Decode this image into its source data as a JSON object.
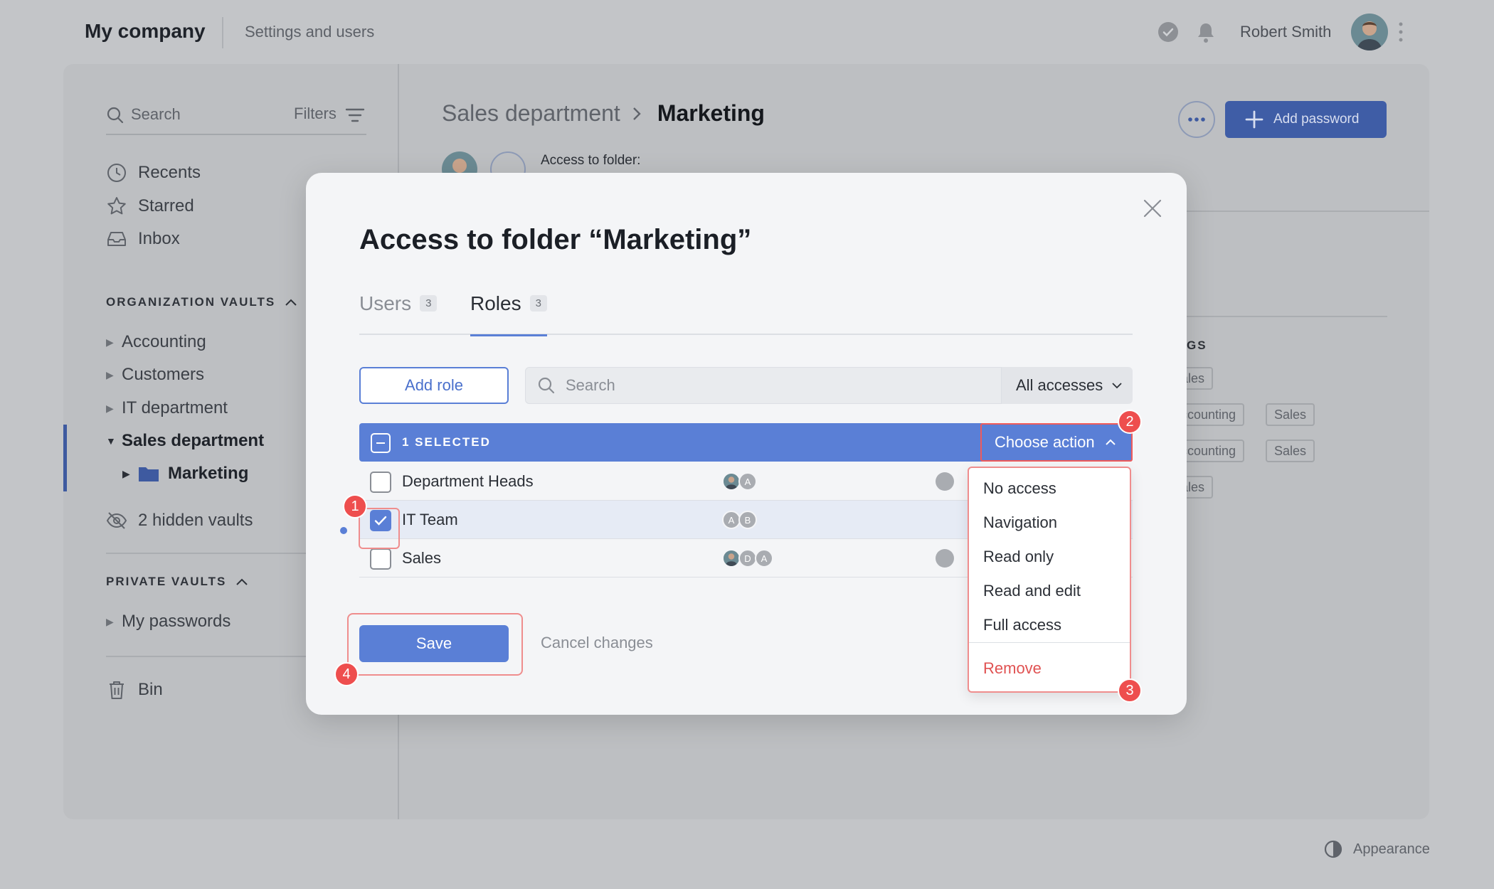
{
  "topbar": {
    "company": "My company",
    "section": "Settings and users",
    "user_name": "Robert Smith"
  },
  "sidebar": {
    "search_placeholder": "Search",
    "filters_label": "Filters",
    "quick": [
      {
        "label": "Recents",
        "icon": "clock-icon"
      },
      {
        "label": "Starred",
        "icon": "star-icon"
      },
      {
        "label": "Inbox",
        "icon": "inbox-icon"
      }
    ],
    "org_vaults_title": "ORGANIZATION VAULTS",
    "org_vaults": [
      "Accounting",
      "Customers",
      "IT department",
      "Sales department"
    ],
    "subfolder": "Marketing",
    "hidden_vaults": "2 hidden vaults",
    "private_vaults_title": "PRIVATE VAULTS",
    "private_vaults": [
      "My passwords"
    ],
    "bin": "Bin"
  },
  "main": {
    "breadcrumb_parent": "Sales department",
    "breadcrumb_current": "Marketing",
    "add_password": "Add password",
    "access_label": "Access to folder:",
    "tags_header": "GS",
    "tags": [
      "ales",
      "ccounting",
      "Sales",
      "ccounting",
      "Sales",
      "ales"
    ]
  },
  "modal": {
    "title": "Access to folder “Marketing”",
    "tabs": [
      {
        "label": "Users",
        "count": "3"
      },
      {
        "label": "Roles",
        "count": "3"
      }
    ],
    "active_tab": "Roles",
    "add_role": "Add role",
    "search_placeholder": "Search",
    "filter_value": "All accesses",
    "selected_text": "1 SELECTED",
    "choose_action": "Choose action",
    "rows": [
      {
        "name": "Department Heads",
        "checked": false,
        "avatars": [
          "photo",
          "A"
        ]
      },
      {
        "name": "IT Team",
        "checked": true,
        "avatars": [
          "A",
          "B"
        ]
      },
      {
        "name": "Sales",
        "checked": false,
        "avatars": [
          "photo",
          "D",
          "A"
        ]
      }
    ],
    "save": "Save",
    "cancel": "Cancel changes",
    "actions": [
      "No access",
      "Navigation",
      "Read only",
      "Read and edit",
      "Full access"
    ],
    "remove": "Remove"
  },
  "badges": [
    "1",
    "2",
    "3",
    "4"
  ],
  "footer": {
    "appearance": "Appearance"
  },
  "colors": {
    "accent": "#5a7fd6",
    "danger": "#e05252",
    "badge": "#ee4e4e"
  }
}
